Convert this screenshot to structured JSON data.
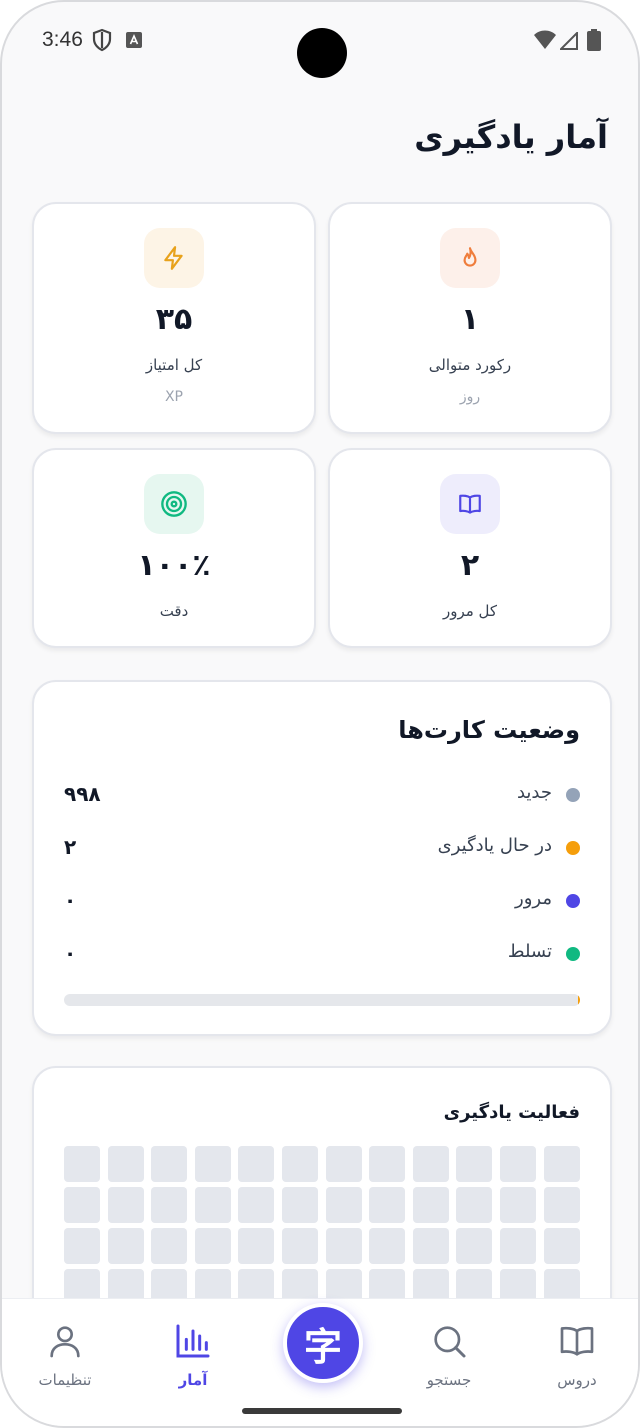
{
  "status_bar": {
    "time": "3:46"
  },
  "page": {
    "title": "آمار یادگیری"
  },
  "stats": [
    {
      "key": "streak",
      "value": "۱",
      "label": "رکورد متوالی",
      "sub": "روز",
      "icon": "flame-icon",
      "icon_bg": "#fdf0ea",
      "icon_color": "#ef7d3c"
    },
    {
      "key": "xp",
      "value": "۳۵",
      "label": "کل امتیاز",
      "sub": "XP",
      "icon": "lightning-icon",
      "icon_bg": "#fdf4e6",
      "icon_color": "#e8a21c"
    },
    {
      "key": "reviews",
      "value": "۲",
      "label": "کل مرور",
      "sub": "",
      "icon": "book-icon",
      "icon_bg": "#eeedfc",
      "icon_color": "#4f46e5"
    },
    {
      "key": "accuracy",
      "value": "۱۰۰٪",
      "label": "دقت",
      "sub": "",
      "icon": "target-icon",
      "icon_bg": "#e6f7f0",
      "icon_color": "#10b981"
    }
  ],
  "card_status": {
    "title": "وضعیت کارت‌ها",
    "rows": [
      {
        "name": "جدید",
        "count": "۹۹۸",
        "color": "#94a3b8"
      },
      {
        "name": "در حال یادگیری",
        "count": "۲",
        "color": "#f59e0b"
      },
      {
        "name": "مرور",
        "count": "۰",
        "color": "#4f46e5"
      },
      {
        "name": "تسلط",
        "count": "۰",
        "color": "#10b981"
      }
    ],
    "progress_learning_fraction": 0.002
  },
  "activity": {
    "title": "فعالیت یادگیری"
  },
  "nav": {
    "items": [
      {
        "key": "lessons",
        "label": "دروس",
        "icon": "book-open-icon"
      },
      {
        "key": "search",
        "label": "جستجو",
        "icon": "search-icon"
      },
      {
        "key": "stats",
        "label": "آمار",
        "icon": "bar-chart-icon",
        "active": true
      },
      {
        "key": "settings",
        "label": "تنظیمات",
        "icon": "user-icon"
      }
    ],
    "center_button": "字"
  },
  "colors": {
    "accent": "#4f46e5",
    "inactive": "#6b7280"
  }
}
